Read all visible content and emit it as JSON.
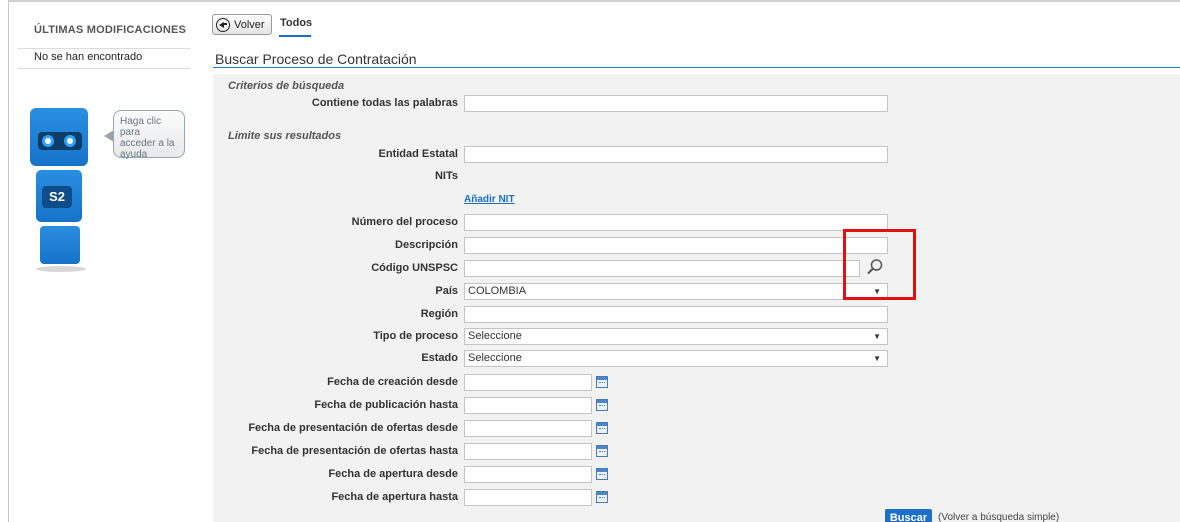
{
  "sidebar": {
    "title": "ÚLTIMAS MODIFICACIONES",
    "empty_text": "No se han encontrado",
    "help_bubble": "Haga clic para acceder a la ayuda",
    "robot_badge": "S2"
  },
  "nav": {
    "back_label": "Volver",
    "tab_label": "Todos"
  },
  "page": {
    "title": "Buscar Proceso de Contratación"
  },
  "form": {
    "section_criteria": "Criterios de búsqueda",
    "section_limit": "Limite sus resultados",
    "fields": {
      "contains_words": {
        "label": "Contiene todas las palabras",
        "value": ""
      },
      "entity": {
        "label": "Entidad Estatal",
        "value": ""
      },
      "nits": {
        "label": "NITs"
      },
      "add_nit": "Añadir NIT",
      "process_number": {
        "label": "Número del proceso",
        "value": ""
      },
      "description": {
        "label": "Descripción",
        "value": ""
      },
      "unspsc": {
        "label": "Código UNSPSC",
        "value": ""
      },
      "country": {
        "label": "País",
        "value": "COLOMBIA"
      },
      "region": {
        "label": "Región",
        "value": ""
      },
      "process_type": {
        "label": "Tipo de proceso",
        "value": "Seleccione"
      },
      "state": {
        "label": "Estado",
        "value": "Seleccione"
      },
      "created_from": {
        "label": "Fecha de creación desde",
        "value": ""
      },
      "published_to": {
        "label": "Fecha de publicación hasta",
        "value": ""
      },
      "offers_from": {
        "label": "Fecha de presentación de ofertas desde",
        "value": ""
      },
      "offers_to": {
        "label": "Fecha de presentación de ofertas hasta",
        "value": ""
      },
      "opening_from": {
        "label": "Fecha de apertura desde",
        "value": ""
      },
      "opening_to": {
        "label": "Fecha de apertura hasta",
        "value": ""
      }
    },
    "search_button": "Buscar",
    "simple_search_link": "(Volver a búsqueda simple)"
  },
  "colors": {
    "accent": "#1d6fcc",
    "highlight": "#e21010",
    "panel_bg": "#f2f2f2"
  },
  "icons": [
    "back-circle-icon",
    "magnifier-icon",
    "calendar-icon",
    "robot-helper-icon"
  ]
}
